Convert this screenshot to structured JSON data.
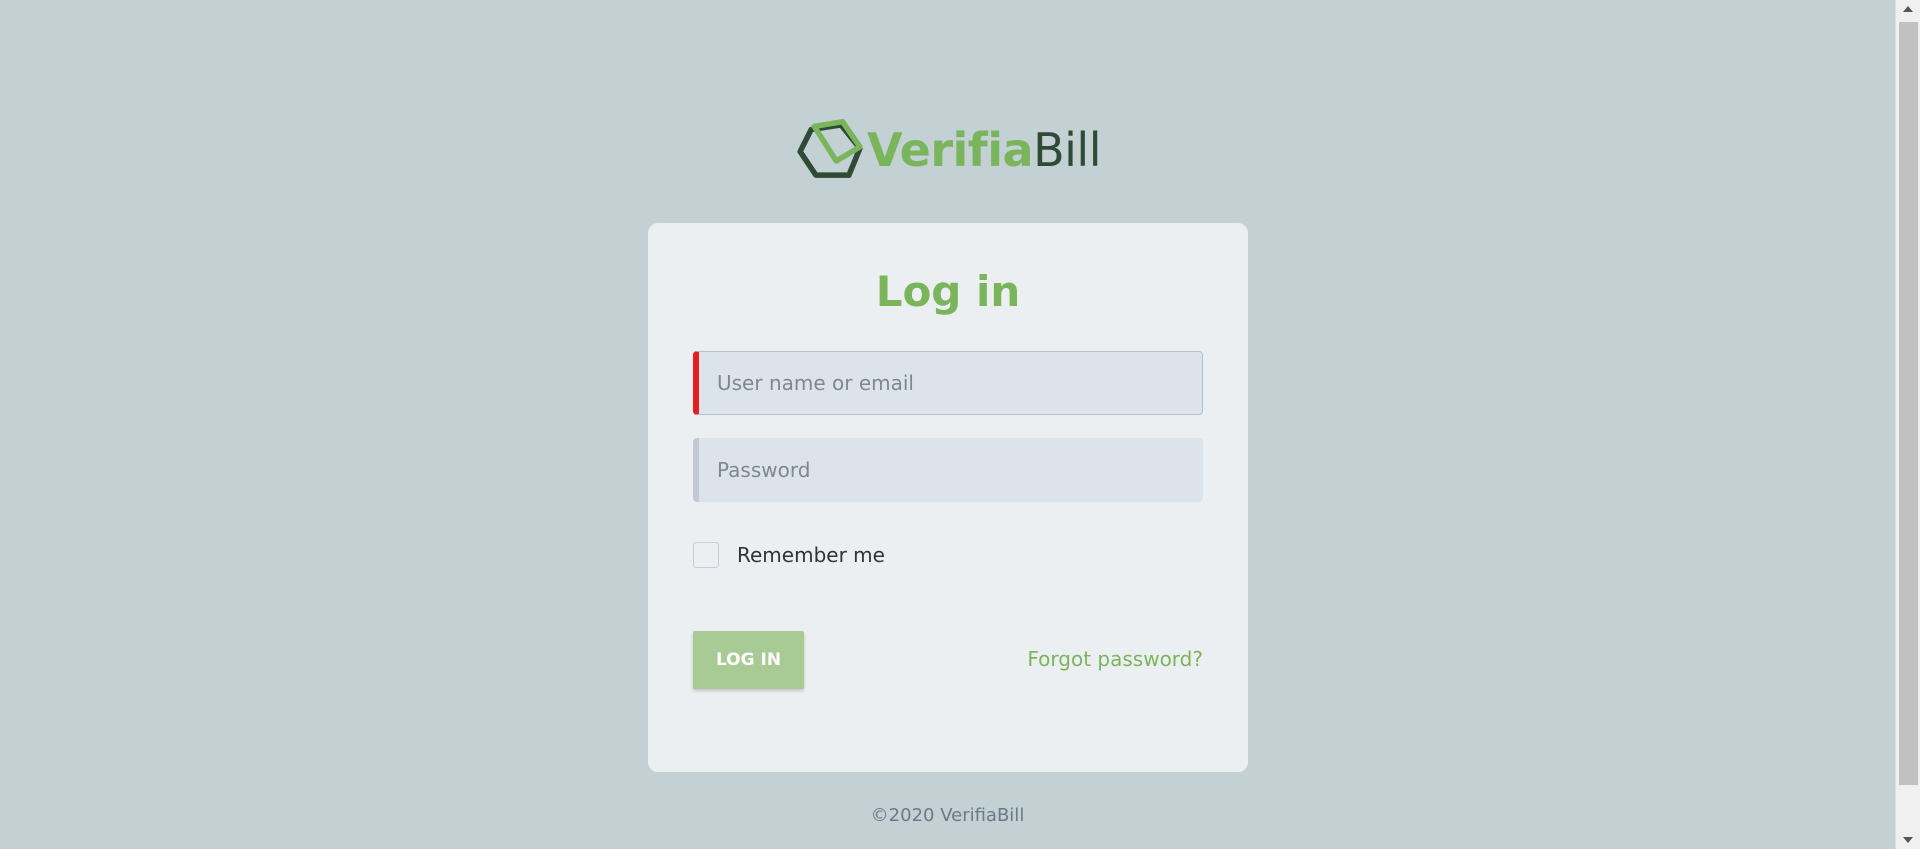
{
  "brand": {
    "name_part1": "Verifia",
    "name_part2": "Bill",
    "logo_icon": "hexagon-logo-icon",
    "accent_color": "#7ab55c",
    "dark_color": "#2f4a35"
  },
  "form": {
    "title": "Log in",
    "username_placeholder": "User name or email",
    "password_placeholder": "Password",
    "remember_label": "Remember me",
    "remember_checked": false,
    "login_button": "LOG IN",
    "forgot_link": "Forgot password?"
  },
  "footer": {
    "text": "©2020 VerifiaBill"
  },
  "colors": {
    "background": "#c3d0d4",
    "card": "#eceff2",
    "error_indicator": "#e41f1f",
    "button": "#a8cb95"
  }
}
